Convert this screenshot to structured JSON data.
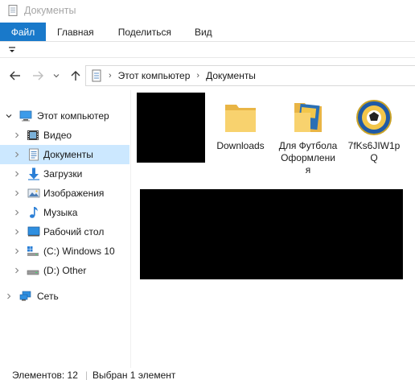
{
  "window": {
    "title": "Документы"
  },
  "ribbon": {
    "tabs": [
      "Файл",
      "Главная",
      "Поделиться",
      "Вид"
    ]
  },
  "address": {
    "crumbs": [
      "Этот компьютер",
      "Документы"
    ]
  },
  "sidebar": {
    "items": [
      {
        "label": "Этот компьютер",
        "icon": "computer-icon"
      },
      {
        "label": "Видео",
        "icon": "video-icon"
      },
      {
        "label": "Документы",
        "icon": "documents-icon"
      },
      {
        "label": "Загрузки",
        "icon": "downloads-icon"
      },
      {
        "label": "Изображения",
        "icon": "pictures-icon"
      },
      {
        "label": "Музыка",
        "icon": "music-icon"
      },
      {
        "label": "Рабочий стол",
        "icon": "desktop-icon"
      },
      {
        "label": "(C:) Windows 10",
        "icon": "drive-c-icon"
      },
      {
        "label": "(D:) Other",
        "icon": "drive-d-icon"
      },
      {
        "label": "Сеть",
        "icon": "network-icon"
      }
    ],
    "selected": "Документы"
  },
  "files": [
    {
      "name": "Downloads",
      "icon": "folder-icon"
    },
    {
      "name": "Для Футбола Оформления",
      "icon": "folder-with-content-icon"
    },
    {
      "name": "7fKs6JIW1pQ",
      "icon": "image-thumbnail-icon"
    }
  ],
  "status": {
    "items_count": "Элементов: 12",
    "selected_count": "Выбран 1 элемент"
  },
  "colors": {
    "accent": "#1979ca",
    "selection": "#cce8ff"
  }
}
